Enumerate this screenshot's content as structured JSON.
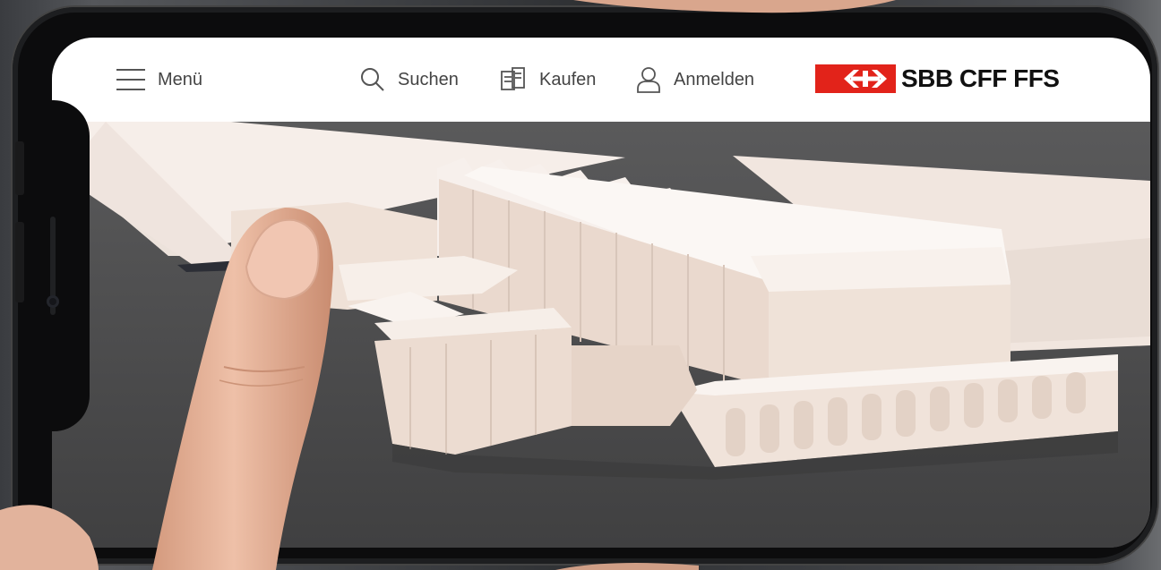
{
  "nav": {
    "menu_label": "Menü",
    "search_label": "Suchen",
    "buy_label": "Kaufen",
    "login_label": "Anmelden"
  },
  "brand": {
    "name": "SBB CFF FFS",
    "color": "#e2231a"
  },
  "icons": {
    "menu": "hamburger-icon",
    "search": "search-icon",
    "buy": "ticket-icon",
    "login": "user-icon"
  }
}
